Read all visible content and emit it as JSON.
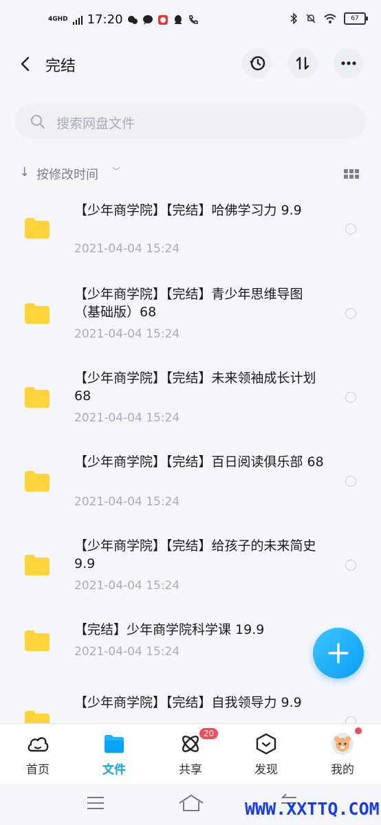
{
  "status_bar": {
    "network": "4GHD",
    "time": "17:20",
    "battery": "67"
  },
  "header": {
    "title": "完结",
    "icons": [
      "back-arrow-icon",
      "history-icon",
      "sort-icon",
      "more-icon"
    ]
  },
  "search": {
    "placeholder": "搜索网盘文件"
  },
  "sort": {
    "label": "按修改时间"
  },
  "files": [
    {
      "name": "【少年商学院】【完结】哈佛学习力 9.9",
      "date": "2021-04-04  15:24"
    },
    {
      "name": "【少年商学院】【完结】青少年思维导图（基础版）68",
      "date": "2021-04-04  15:24"
    },
    {
      "name": "【少年商学院】【完结】未来领袖成长计划 68",
      "date": "2021-04-04  15:24"
    },
    {
      "name": "【少年商学院】【完结】百日阅读俱乐部 68",
      "date": "2021-04-04  15:24"
    },
    {
      "name": "【少年商学院】【完结】给孩子的未来简史 9.9",
      "date": "2021-04-04  15:24"
    },
    {
      "name": "【完结】少年商学院科学课 19.9",
      "date": "2021-04-04  15:24"
    },
    {
      "name": "【少年商学院】【完结】自我领导力 9.9",
      "date": ""
    }
  ],
  "tabs": [
    {
      "label": "首页"
    },
    {
      "label": "文件"
    },
    {
      "label": "共享"
    },
    {
      "label": "发现"
    },
    {
      "label": "我的"
    }
  ],
  "share_badge": "20",
  "watermark": "WWW.XXTTQ.COM",
  "colors": {
    "accent": "#0aa3f5",
    "folder": "#ffd43b",
    "badge": "#f24b5c",
    "watermark": "#1a3cf0"
  }
}
